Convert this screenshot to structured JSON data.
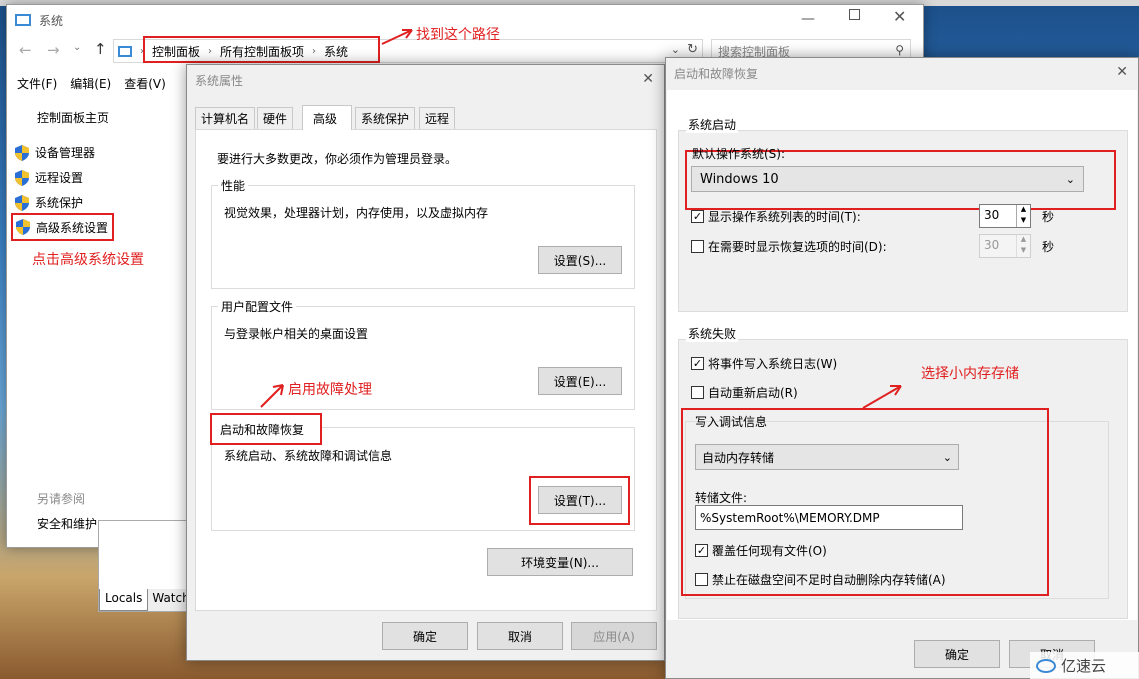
{
  "system_window": {
    "title": "系统",
    "breadcrumb": [
      "控制面板",
      "所有控制面板项",
      "系统"
    ],
    "search_placeholder": "搜索控制面板",
    "menu": [
      "文件(F)",
      "编辑(E)",
      "查看(V)"
    ],
    "home_link": "控制面板主页",
    "nav_items": [
      "设备管理器",
      "远程设置",
      "系统保护",
      "高级系统设置"
    ],
    "see_also_title": "另请参阅",
    "see_also_item": "安全和维护"
  },
  "bg_tabs": [
    "Locals",
    "Watch"
  ],
  "sys_props": {
    "title": "系统属性",
    "tabs": [
      "计算机名",
      "硬件",
      "高级",
      "系统保护",
      "远程"
    ],
    "admin_note": "要进行大多数更改，你必须作为管理员登录。",
    "perf_title": "性能",
    "perf_desc": "视觉效果，处理器计划，内存使用，以及虚拟内存",
    "perf_btn": "设置(S)...",
    "profile_title": "用户配置文件",
    "profile_desc": "与登录帐户相关的桌面设置",
    "profile_btn": "设置(E)...",
    "startup_title": "启动和故障恢复",
    "startup_desc": "系统启动、系统故障和调试信息",
    "startup_btn": "设置(T)...",
    "env_btn": "环境变量(N)...",
    "ok": "确定",
    "cancel": "取消",
    "apply": "应用(A)"
  },
  "startup_dlg": {
    "title": "启动和故障恢复",
    "sys_start_title": "系统启动",
    "default_os_label": "默认操作系统(S):",
    "default_os_value": "Windows 10",
    "show_list_label": "显示操作系统列表的时间(T):",
    "show_list_checked": true,
    "show_list_value": "30",
    "show_recovery_label": "在需要时显示恢复选项的时间(D):",
    "show_recovery_checked": false,
    "show_recovery_value": "30",
    "seconds": "秒",
    "failure_title": "系统失败",
    "write_event_label": "将事件写入系统日志(W)",
    "write_event_checked": true,
    "auto_restart_label": "自动重新启动(R)",
    "auto_restart_checked": false,
    "debug_title": "写入调试信息",
    "debug_value": "自动内存转储",
    "dump_file_label": "转储文件:",
    "dump_file_value": "%SystemRoot%\\MEMORY.DMP",
    "overwrite_label": "覆盖任何现有文件(O)",
    "overwrite_checked": true,
    "disable_auto_delete_label": "禁止在磁盘空间不足时自动删除内存转储(A)",
    "disable_auto_delete_checked": false,
    "ok": "确定",
    "cancel": "取消"
  },
  "annotations": {
    "find_path": "找到这个路径",
    "click_advanced": "点击高级系统设置",
    "enable_fault": "启用故障处理",
    "choose_small": "选择小内存存储"
  },
  "watermark": "亿速云",
  "colors": {
    "annotation_red": "#e02020",
    "shield_blue": "#2a6fd6",
    "shield_yellow": "#f2c12e"
  }
}
